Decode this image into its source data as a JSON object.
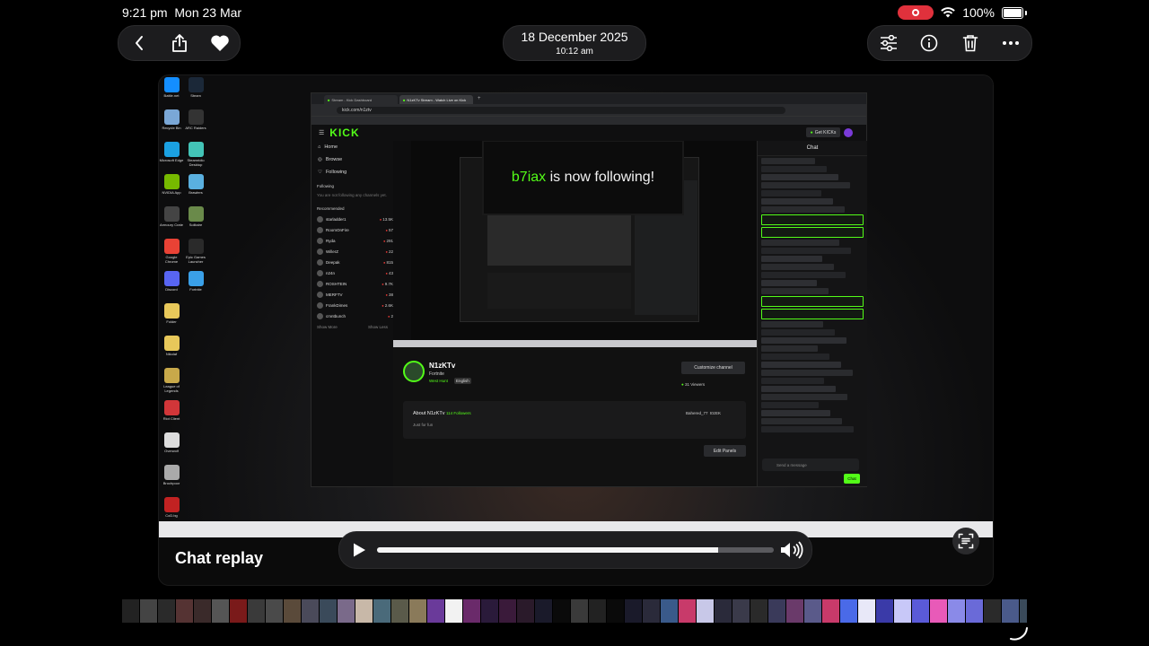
{
  "status_bar": {
    "time": "9:21 pm",
    "date": "Mon 23 Mar",
    "battery": "100%"
  },
  "header": {
    "date": "18 December 2025",
    "time": "10:12 am"
  },
  "media": {
    "caption": "Chat replay",
    "progress": 0.86
  },
  "desktop_icons": [
    {
      "label": "Battle.net",
      "color": "#148eff"
    },
    {
      "label": "Steam",
      "color": "#1b2838"
    },
    {
      "label": "Recycle Bin",
      "color": "#7aa7d6"
    },
    {
      "label": "ARC Raiders",
      "color": "#333333"
    },
    {
      "label": "Microsoft Edge",
      "color": "#1ba1e2"
    },
    {
      "label": "Steamridio Desktop",
      "color": "#43c4b7"
    },
    {
      "label": "NVIDIA App",
      "color": "#76b900"
    },
    {
      "label": "Brawlers",
      "color": "#5ab0e0"
    },
    {
      "label": "Armoury Crate",
      "color": "#444444"
    },
    {
      "label": "Solitaire",
      "color": "#6a8a4a"
    },
    {
      "label": "Google Chrome",
      "color": "#e94235"
    },
    {
      "label": "Epic Games Launcher",
      "color": "#2a2a2a"
    },
    {
      "label": "Discord",
      "color": "#5865f2"
    },
    {
      "label": "Fortnite",
      "color": "#3aa0e8"
    },
    {
      "label": "Folder",
      "color": "#e8c85a"
    },
    {
      "label": "Nikolaf",
      "color": "#e8c85a"
    },
    {
      "label": "League of Legends",
      "color": "#c8a94a"
    },
    {
      "label": "Riot Client",
      "color": "#d13639"
    },
    {
      "label": "Overwolf",
      "color": "#dddddd"
    },
    {
      "label": "Brochpoor",
      "color": "#aaaaaa"
    },
    {
      "label": "CoD.bg",
      "color": "#c22222"
    }
  ],
  "browser": {
    "tabs": [
      "Stream - Kick Dashboard",
      "N1zKTv Stream - Watch Live on Kick"
    ],
    "url": "kick.com/n1ztv",
    "logo": "KICK",
    "get_kick": "Get KICKs",
    "nav": [
      "Home",
      "Browse",
      "Following"
    ],
    "following_title": "Following",
    "following_empty": "You are not following any channels yet.",
    "recommended_title": "Recommended",
    "recommended": [
      {
        "name": "starladder1",
        "count": "13.5K"
      },
      {
        "name": "RoomOnFire",
        "count": "57"
      },
      {
        "name": "Ryda",
        "count": "291"
      },
      {
        "name": "WillerZ",
        "count": "22"
      },
      {
        "name": "Deepak",
        "count": "815"
      },
      {
        "name": "n24n",
        "count": "43"
      },
      {
        "name": "ROSHTEIN",
        "count": "9.7K"
      },
      {
        "name": "MERFTV",
        "count": "38"
      },
      {
        "name": "FrankDimes",
        "count": "2.6K"
      },
      {
        "name": "cmntbunch",
        "count": "2"
      }
    ],
    "show_more": "Show More",
    "show_less": "Show Less",
    "follow_alert_user": "b7iax",
    "follow_alert_text": "is now following!",
    "channel": {
      "name": "N1zKTv",
      "game": "Fortnite",
      "tag1": "West Hunt",
      "tag2": "English",
      "customize": "Customize channel",
      "viewers": "31 Viewers",
      "about_title": "About N1zKTv",
      "followers": "114 Followers",
      "about_text": "Just for fun",
      "social1": "Bahered_77",
      "social2": "t0zEK",
      "edit_panels": "Edit Panels"
    },
    "chat": {
      "title": "Chat",
      "placeholder": "Send a message",
      "send": "Chat"
    }
  },
  "filmstrip_colors": [
    "#222",
    "#444",
    "#2a2a2a",
    "#553333",
    "#3a2a2a",
    "#555",
    "#7a1a1a",
    "#3a3a3a",
    "#4a4a4a",
    "#5a4a3a",
    "#4a4a5a",
    "#3a4a5a",
    "#7a6a8a",
    "#c8b8a8",
    "#4a6a7a",
    "#5a5a4a",
    "#8a7a5a",
    "#6a3a9a",
    "#f2f2f2",
    "#6a2a6a",
    "#2a1a3a",
    "#3a1a3a",
    "#2a1a2a",
    "#1a1a2a",
    "#0a0a0a",
    "#3a3a3a",
    "#222",
    "#0a0a0a",
    "#1a1a2a",
    "#2a2a3a",
    "#3a5a8a",
    "#c83a6a",
    "#c8c8e8",
    "#2a2a3a",
    "#3a3a4a",
    "#2a2a2a",
    "#3a3a5a",
    "#6a3a6a",
    "#5a5a8a",
    "#c83a6a",
    "#4a6ae8",
    "#e8e8f8",
    "#3a3aa8",
    "#c8c8f8",
    "#5a5ad8",
    "#e85ab8",
    "#8a8ae8",
    "#6a6ad8",
    "#2a2a2a",
    "#4a5a8a",
    "#3a4a5a",
    "#c8c8d8",
    "#5a3a9a",
    "#3a3a3a",
    "#e8e8e8",
    "#1a1a1a"
  ]
}
